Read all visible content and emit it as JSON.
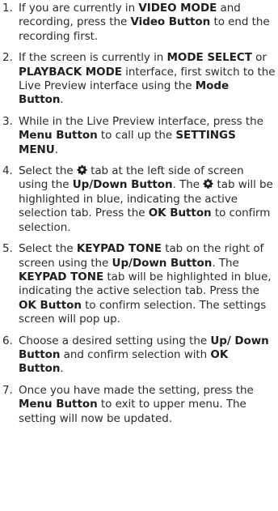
{
  "steps": [
    {
      "num": "1.",
      "parts": [
        {
          "t": "If you are currently in "
        },
        {
          "t": "VIDEO MODE",
          "b": true
        },
        {
          "t": " and recording, press the "
        },
        {
          "t": "Video Button",
          "b": true
        },
        {
          "t": " to end the recording first."
        }
      ]
    },
    {
      "num": "2.",
      "parts": [
        {
          "t": "If the screen is currently in "
        },
        {
          "t": "MODE SELECT",
          "b": true
        },
        {
          "t": " or "
        },
        {
          "t": "PLAYBACK MODE",
          "b": true
        },
        {
          "t": " interface, first switch to the Live Preview interface using the "
        },
        {
          "t": "Mode Button",
          "b": true
        },
        {
          "t": "."
        }
      ]
    },
    {
      "num": "3.",
      "parts": [
        {
          "t": "While in the Live Preview interface, press the "
        },
        {
          "t": "Menu Button",
          "b": true
        },
        {
          "t": " to call up the "
        },
        {
          "t": "SETTINGS MENU",
          "b": true
        },
        {
          "t": "."
        }
      ]
    },
    {
      "num": "4.",
      "parts": [
        {
          "t": "Select the "
        },
        {
          "icon": "gear-icon"
        },
        {
          "t": " tab at the left side of screen using the "
        },
        {
          "t": "Up/Down Button",
          "b": true
        },
        {
          "t": ". The "
        },
        {
          "icon": "gear-icon"
        },
        {
          "t": " tab will be highlighted in blue, indicating the active selection tab. Press the "
        },
        {
          "t": "OK Button",
          "b": true
        },
        {
          "t": " to confirm selection."
        }
      ]
    },
    {
      "num": "5.",
      "parts": [
        {
          "t": "Select the "
        },
        {
          "t": "KEYPAD TONE",
          "b": true
        },
        {
          "t": " tab on the right of screen using the "
        },
        {
          "t": "Up/Down Button",
          "b": true
        },
        {
          "t": ". The "
        },
        {
          "t": "KEYPAD TONE",
          "b": true
        },
        {
          "t": " tab will be highlighted in blue, indicating the active selection tab. Press the "
        },
        {
          "t": "OK Button",
          "b": true
        },
        {
          "t": " to confirm selection. The settings screen will pop up."
        }
      ]
    },
    {
      "num": "6.",
      "parts": [
        {
          "t": "Choose a desired setting using the "
        },
        {
          "t": "Up/ Down Button",
          "b": true
        },
        {
          "t": " and confirm selection with "
        },
        {
          "t": "OK Button",
          "b": true
        },
        {
          "t": "."
        }
      ]
    },
    {
      "num": "7.",
      "parts": [
        {
          "t": "Once you have made the setting, press the "
        },
        {
          "t": "Menu Button",
          "b": true
        },
        {
          "t": " to exit to upper menu. The setting will now be updated."
        }
      ]
    }
  ]
}
